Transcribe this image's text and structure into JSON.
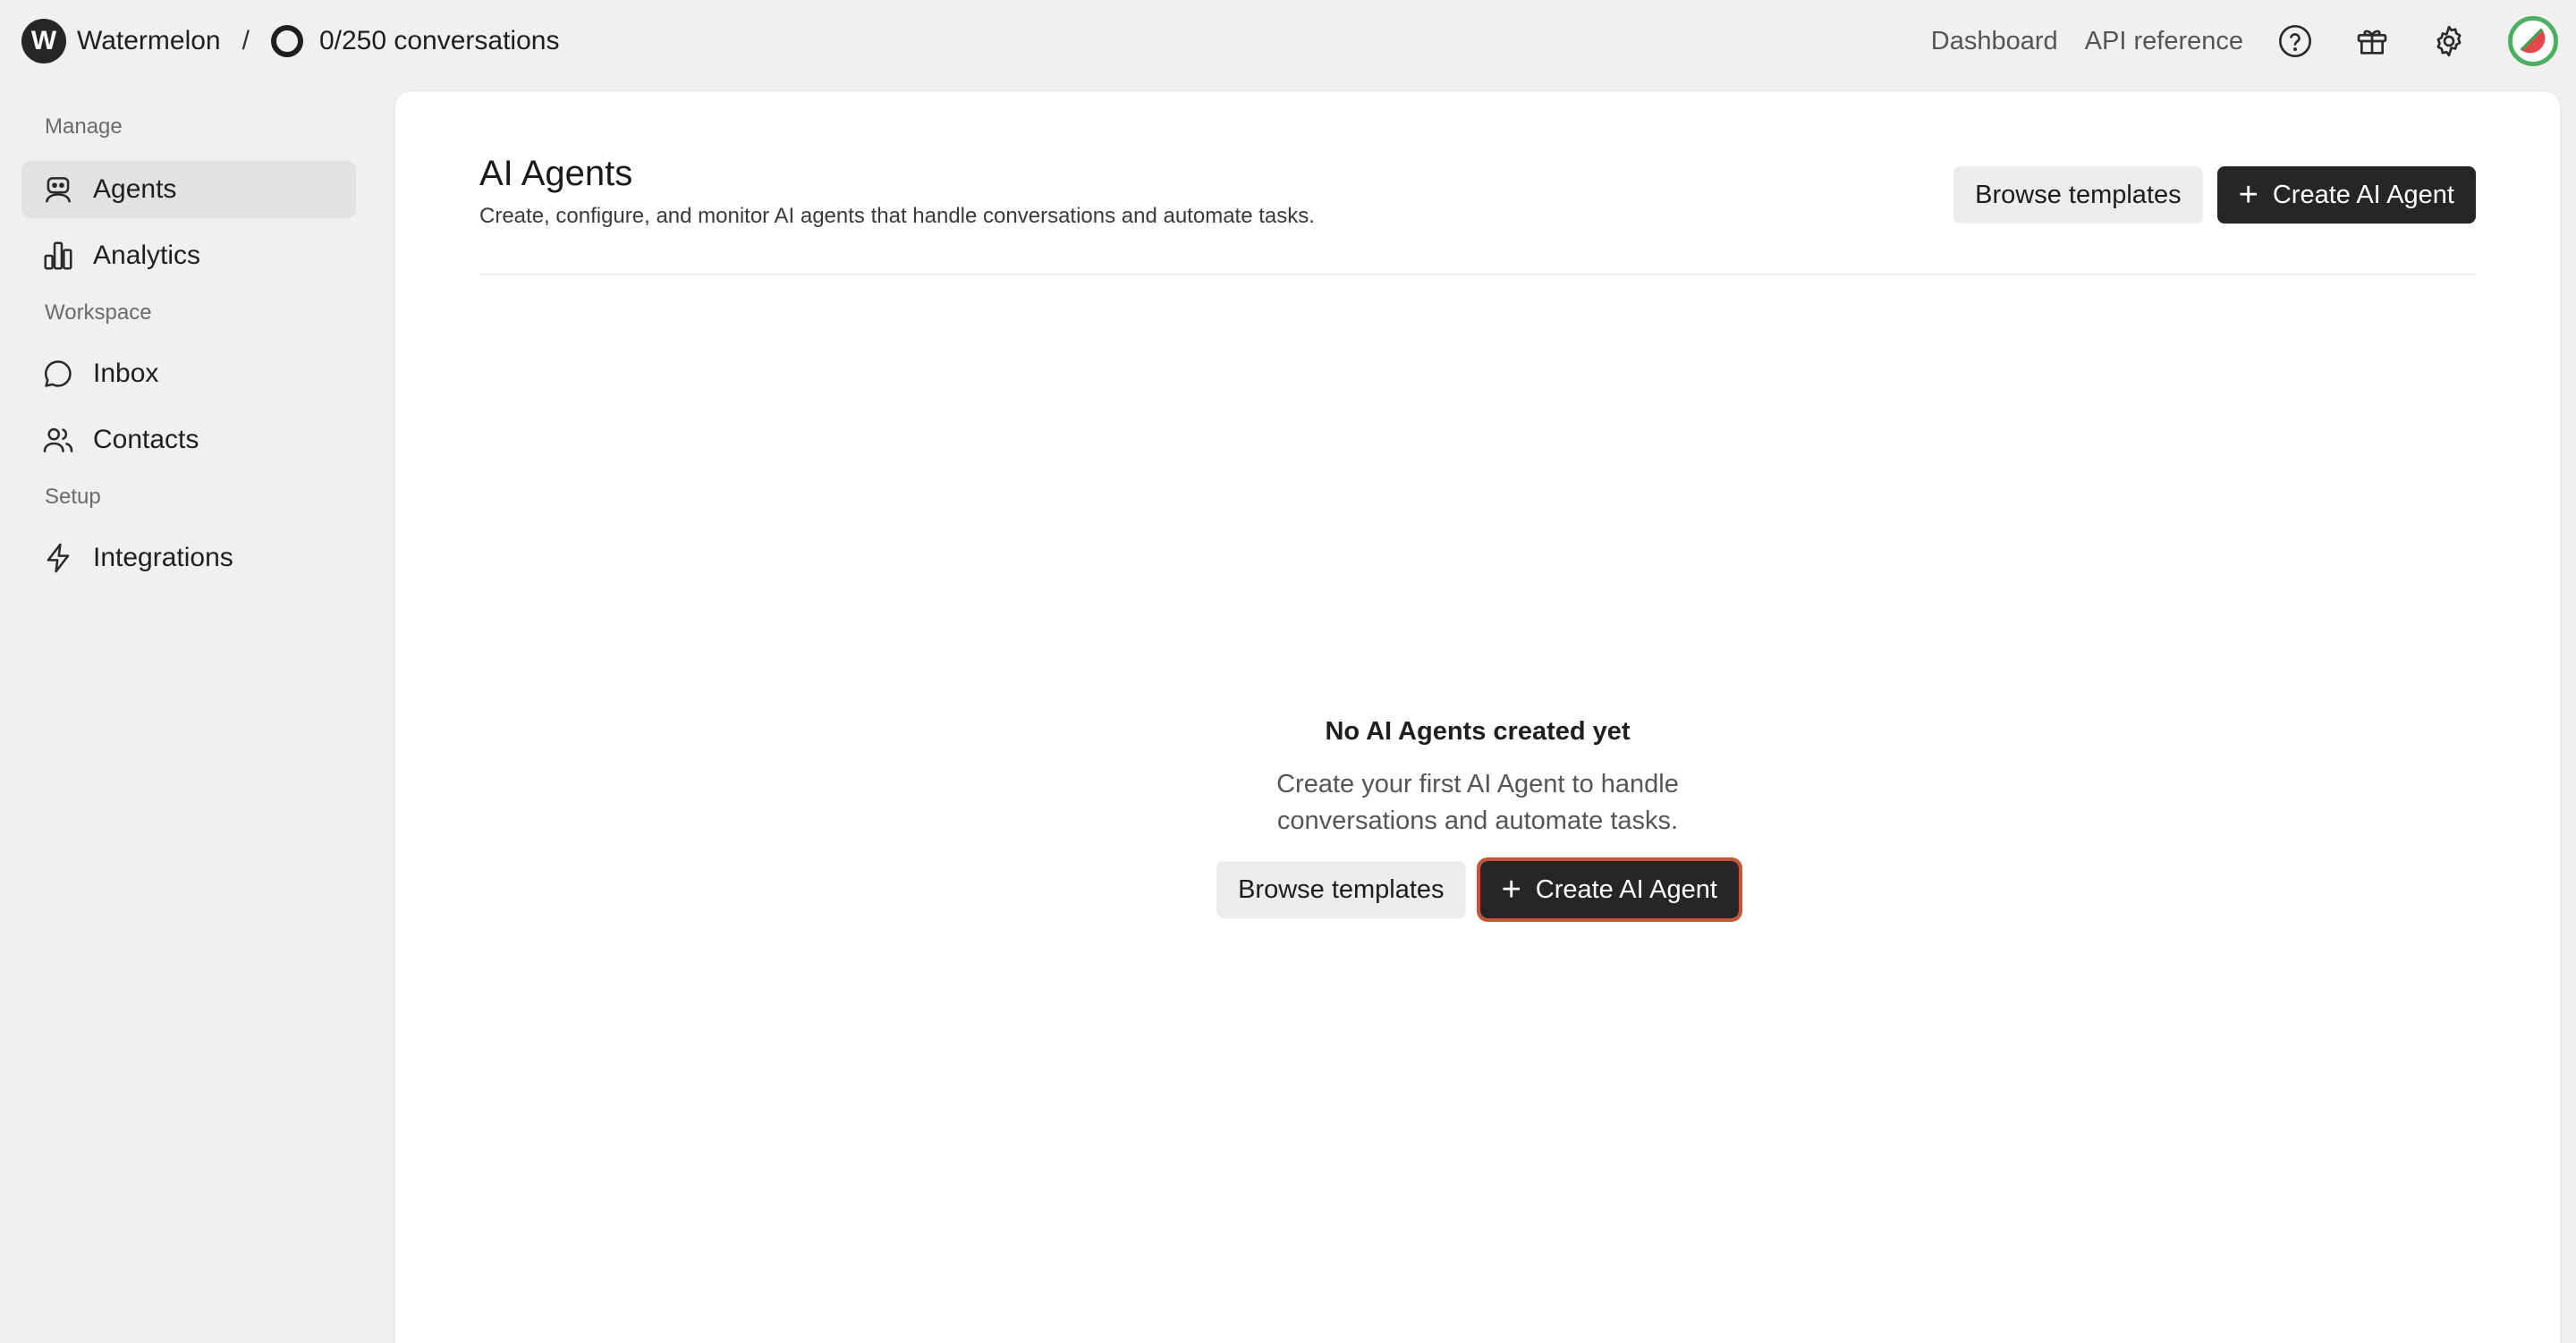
{
  "topbar": {
    "logo_letter": "W",
    "brand": "Watermelon",
    "separator": "/",
    "conversations": "0/250 conversations",
    "links": {
      "dashboard": "Dashboard",
      "api_reference": "API reference"
    },
    "icons": [
      "help-circle-icon",
      "gift-icon",
      "gear-icon",
      "avatar"
    ]
  },
  "sidebar": {
    "sections": [
      {
        "label": "Manage",
        "items": [
          {
            "label": "Agents",
            "icon": "bot-icon",
            "active": true
          },
          {
            "label": "Analytics",
            "icon": "bar-chart-icon"
          }
        ]
      },
      {
        "label": "Workspace",
        "items": [
          {
            "label": "Inbox",
            "icon": "chat-bubble-icon"
          },
          {
            "label": "Contacts",
            "icon": "users-icon"
          }
        ]
      },
      {
        "label": "Setup",
        "items": [
          {
            "label": "Integrations",
            "icon": "lightning-icon"
          }
        ]
      }
    ]
  },
  "main": {
    "title": "AI Agents",
    "subtitle": "Create, configure, and monitor AI agents that handle conversations and automate tasks.",
    "browse_label": "Browse templates",
    "create_label": "Create AI Agent",
    "empty": {
      "title": "No AI Agents created yet",
      "desc_line1": "Create your first AI Agent to handle",
      "desc_line2": "conversations and automate tasks.",
      "browse_label": "Browse templates",
      "create_label": "Create AI Agent"
    }
  },
  "colors": {
    "accent_dark": "#262626",
    "highlight_outline": "#c8553a",
    "avatar_ring": "#4caf62"
  }
}
